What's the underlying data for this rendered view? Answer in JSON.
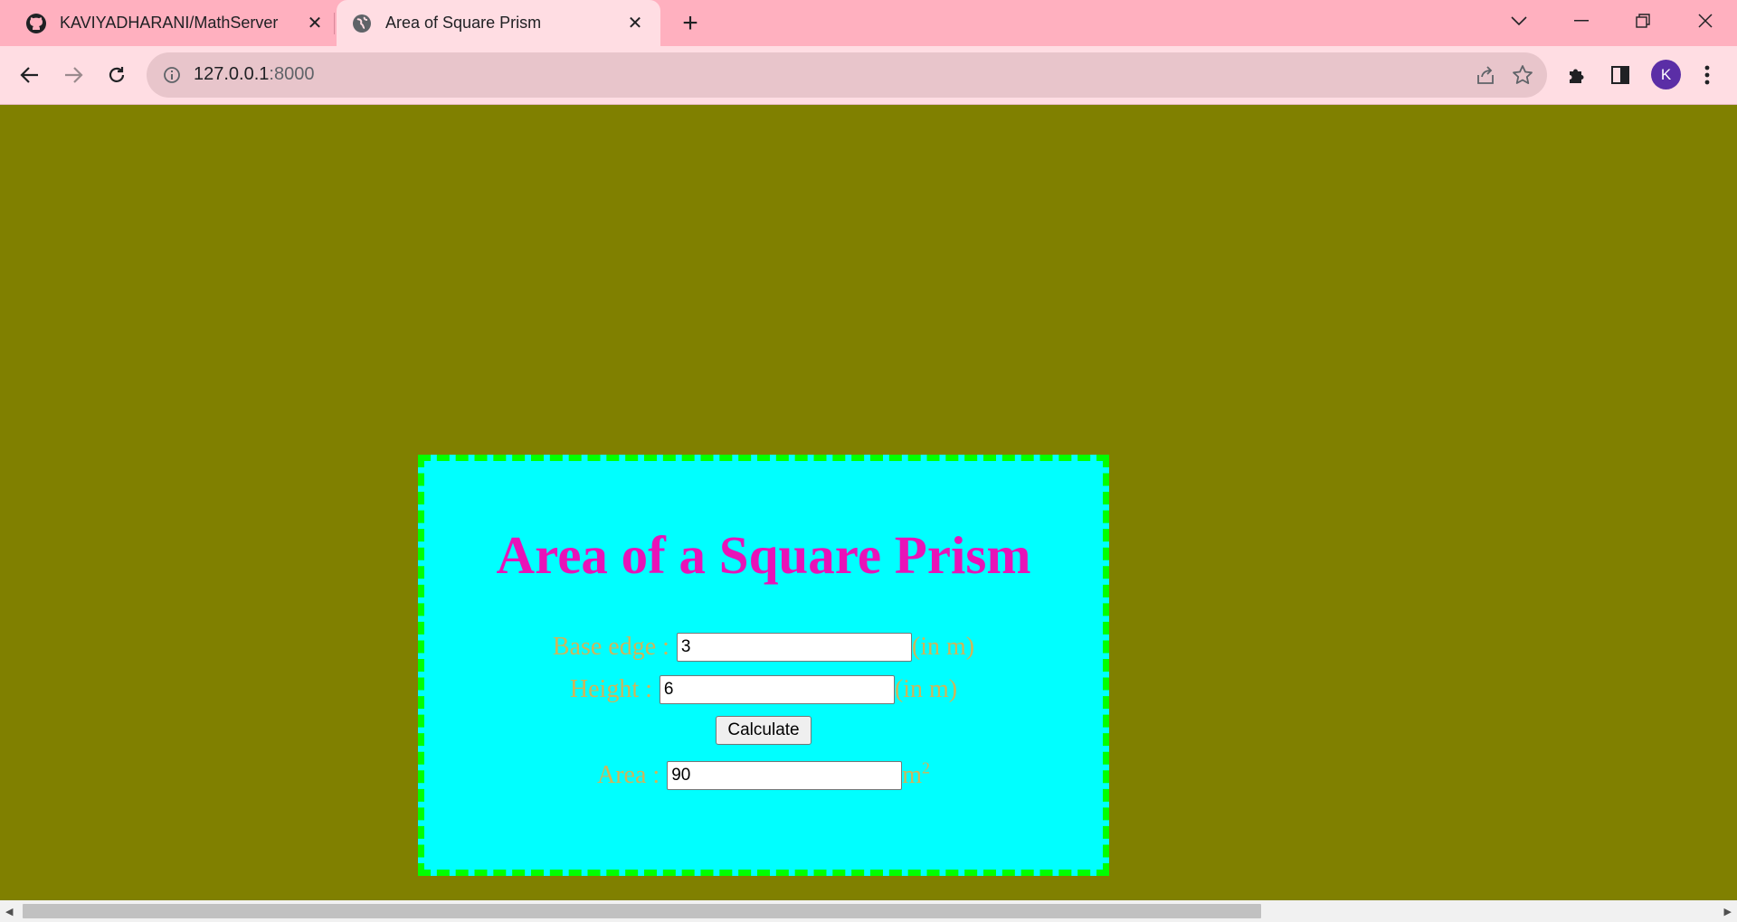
{
  "browser": {
    "tabs": [
      {
        "title": "KAVIYADHARANI/MathServer",
        "icon": "github-icon",
        "active": false
      },
      {
        "title": "Area of Square Prism",
        "icon": "globe-icon",
        "active": true
      }
    ],
    "url_host": "127.0.0.1",
    "url_port": ":8000"
  },
  "profile": {
    "initial": "K"
  },
  "page": {
    "heading": "Area of a Square Prism",
    "base_edge": {
      "label": "Base edge : ",
      "value": "3",
      "unit": "(in m)"
    },
    "height": {
      "label": "Height : ",
      "value": "6",
      "unit": "(in m)"
    },
    "calculate_label": "Calculate",
    "area": {
      "label": "Area : ",
      "value": "90",
      "unit": "m",
      "unit_sup": "2"
    }
  },
  "colors": {
    "page_background": "#808000",
    "panel_background": "#00ffff",
    "panel_border": "#00ff00",
    "heading_color": "#e813b8",
    "label_color": "#cfb55a",
    "tabstrip": "#ffb0bf"
  }
}
